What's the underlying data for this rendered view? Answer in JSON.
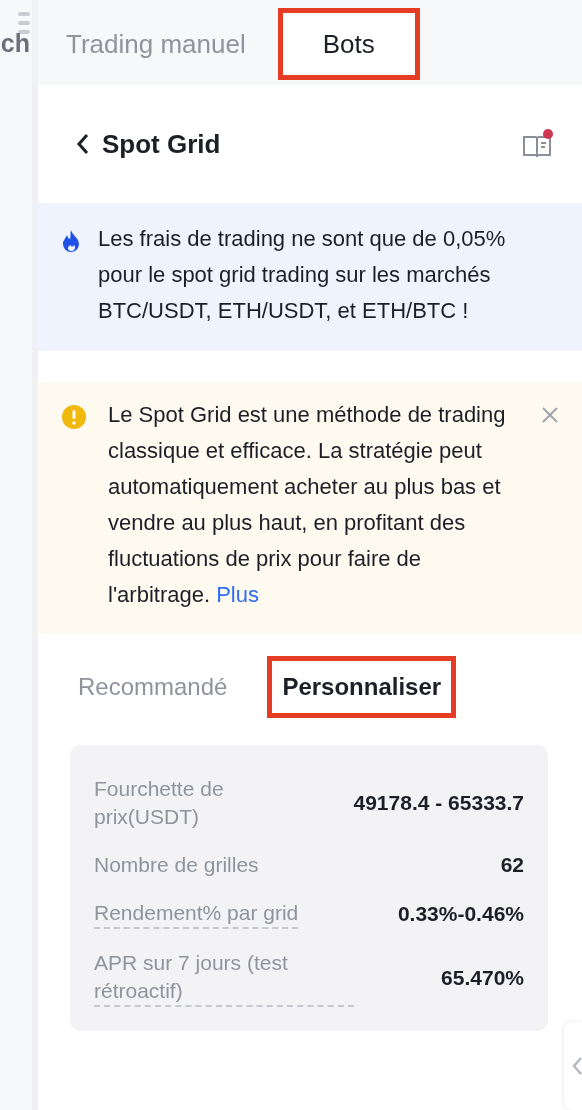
{
  "side_strip": {
    "label": "ch"
  },
  "tabs": [
    {
      "label": "Trading manuel",
      "selected": false,
      "highlighted": false
    },
    {
      "label": "Bots",
      "selected": true,
      "highlighted": true
    }
  ],
  "header": {
    "title": "Spot Grid",
    "notification": true
  },
  "promo": {
    "text": "Les frais de trading ne sont que de 0,05% pour le spot grid trading sur les marchés BTC/USDT, ETH/USDT, et ETH/BTC !"
  },
  "notice": {
    "text": "Le Spot Grid est une méthode de trading classique et efficace. La stratégie peut automatiquement acheter au plus bas et vendre au plus haut, en profitant des fluctuations de prix pour faire de l'arbitrage.",
    "link": "Plus"
  },
  "mode_tabs": [
    {
      "label": "Recommandé",
      "selected": false,
      "highlighted": false
    },
    {
      "label": "Personnaliser",
      "selected": true,
      "highlighted": true
    }
  ],
  "params": [
    {
      "label": "Fourchette de prix(USDT)",
      "value": "49178.4 - 65333.7",
      "dashed": false
    },
    {
      "label": "Nombre de grilles",
      "value": "62",
      "dashed": false
    },
    {
      "label": "Rendement% par grid",
      "value": "0.33%-0.46%",
      "dashed": true
    },
    {
      "label": "APR sur 7 jours (test rétroactif)",
      "value": "65.470%",
      "dashed": true
    }
  ]
}
